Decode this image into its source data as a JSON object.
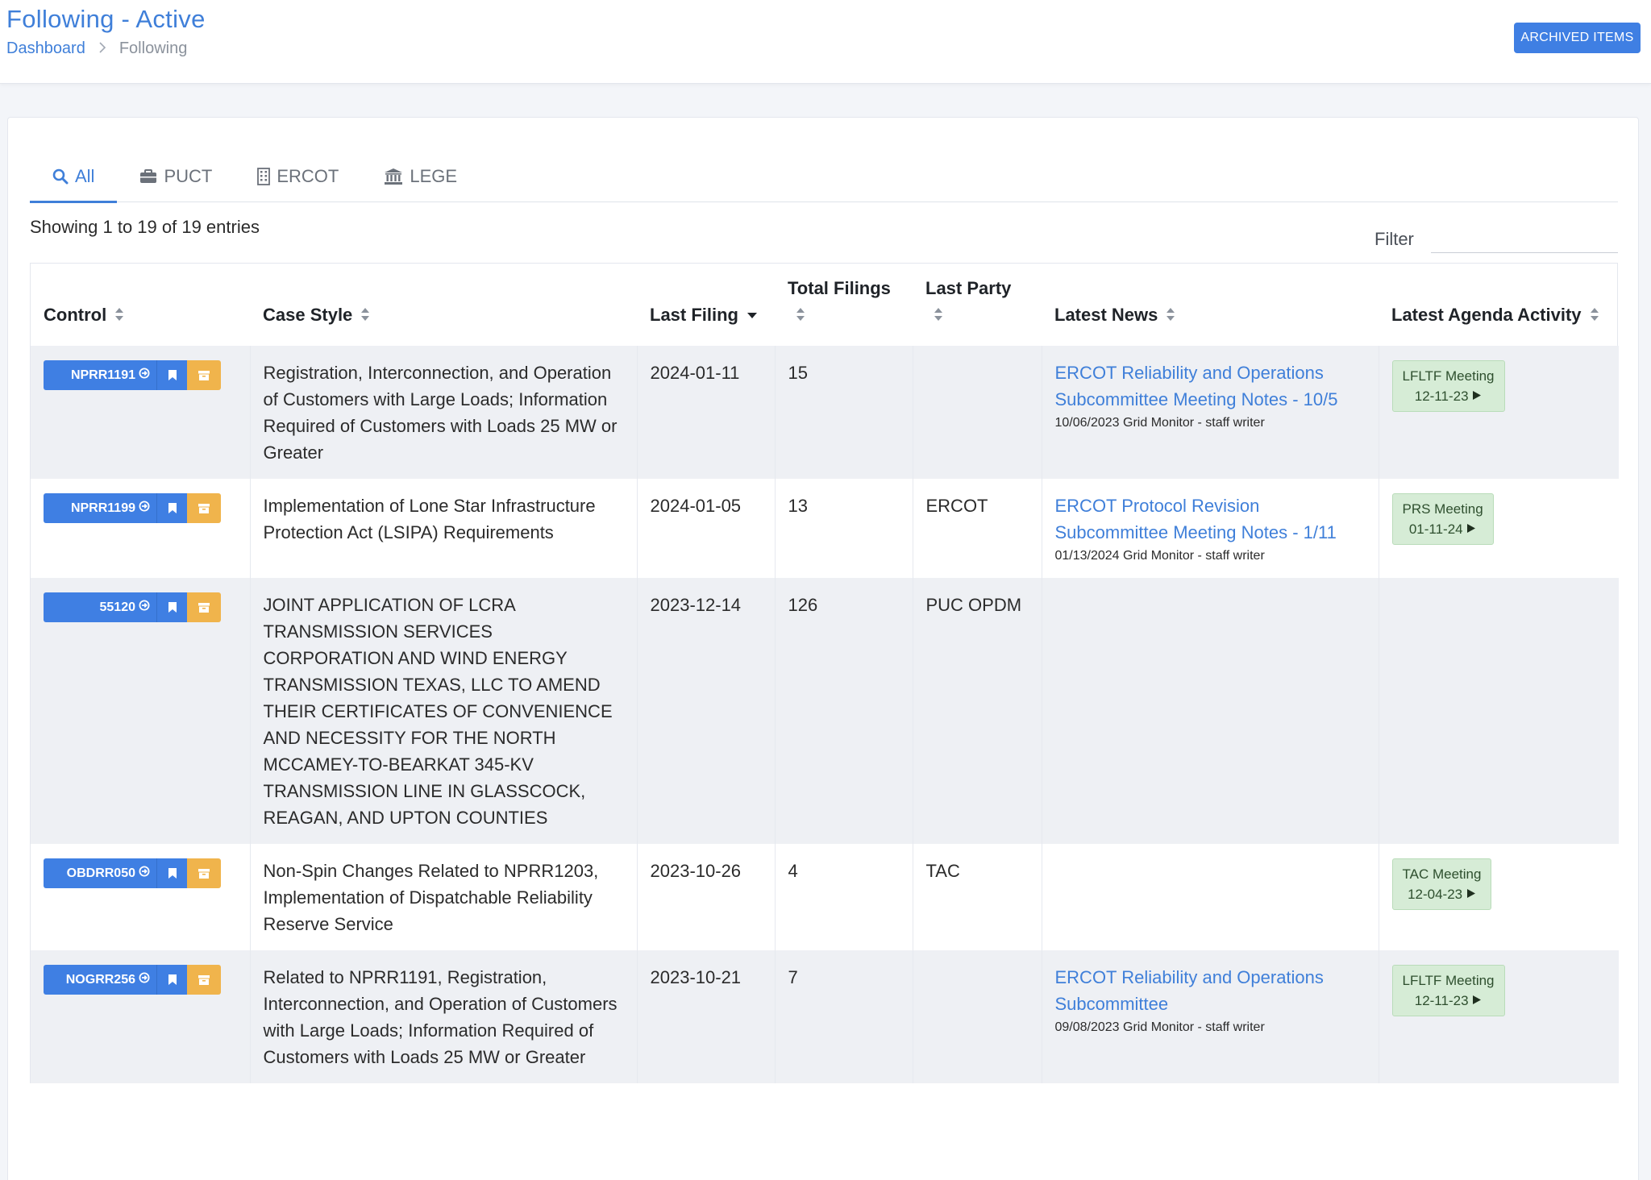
{
  "header": {
    "title": "Following - Active",
    "breadcrumb": {
      "home": "Dashboard",
      "separator": ">",
      "current": "Following"
    },
    "archived_label": "ARCHIVED ITEMS"
  },
  "tabs": [
    {
      "label": "All",
      "icon": "search-icon",
      "active": true
    },
    {
      "label": "PUCT",
      "icon": "briefcase-icon",
      "active": false
    },
    {
      "label": "ERCOT",
      "icon": "building-icon",
      "active": false
    },
    {
      "label": "LEGE",
      "icon": "bank-icon",
      "active": false
    }
  ],
  "table_info": {
    "showing": "Showing 1 to 19 of 19 entries",
    "filter_label": "Filter",
    "filter_value": ""
  },
  "columns": {
    "control": "Control",
    "case_style": "Case Style",
    "last_filing": "Last Filing",
    "total_filings": "Total Filings",
    "last_party": "Last Party",
    "latest_news": "Latest News",
    "latest_agenda": "Latest Agenda Activity"
  },
  "rows": [
    {
      "control": "NPRR1191",
      "case_style": "Registration, Interconnection, and Operation of Customers with Large Loads; Information Required of Customers with Loads 25 MW or Greater",
      "last_filing": "2024-01-11",
      "total_filings": "15",
      "last_party": "",
      "news_title": "ERCOT Reliability and Operations Subcommittee Meeting Notes - 10/5",
      "news_meta": "10/06/2023 Grid Monitor - staff writer",
      "agenda_name": "LFLTF Meeting",
      "agenda_date": "12-11-23"
    },
    {
      "control": "NPRR1199",
      "case_style": "Implementation of Lone Star Infrastructure Protection Act (LSIPA) Requirements",
      "last_filing": "2024-01-05",
      "total_filings": "13",
      "last_party": "ERCOT",
      "news_title": "ERCOT Protocol Revision Subcommittee Meeting Notes - 1/11",
      "news_meta": "01/13/2024 Grid Monitor - staff writer",
      "agenda_name": "PRS Meeting",
      "agenda_date": "01-11-24"
    },
    {
      "control": "55120",
      "case_style": "JOINT APPLICATION OF LCRA TRANSMISSION SERVICES CORPORATION AND WIND ENERGY TRANSMISSION TEXAS, LLC TO AMEND THEIR CERTIFICATES OF CONVENIENCE AND NECESSITY FOR THE NORTH MCCAMEY-TO-BEARKAT 345-KV TRANSMISSION LINE IN GLASSCOCK, REAGAN, AND UPTON COUNTIES",
      "last_filing": "2023-12-14",
      "total_filings": "126",
      "last_party": "PUC OPDM",
      "news_title": "",
      "news_meta": "",
      "agenda_name": "",
      "agenda_date": ""
    },
    {
      "control": "OBDRR050",
      "case_style": "Non-Spin Changes Related to NPRR1203, Implementation of Dispatchable Reliability Reserve Service",
      "last_filing": "2023-10-26",
      "total_filings": "4",
      "last_party": "TAC",
      "news_title": "",
      "news_meta": "",
      "agenda_name": "TAC Meeting",
      "agenda_date": "12-04-23"
    },
    {
      "control": "NOGRR256",
      "case_style": "Related to NPRR1191, Registration, Interconnection, and Operation of Customers with Large Loads; Information Required of Customers with Loads 25 MW or Greater",
      "last_filing": "2023-10-21",
      "total_filings": "7",
      "last_party": "",
      "news_title": "ERCOT Reliability and Operations Subcommittee",
      "news_meta": "09/08/2023 Grid Monitor - staff writer",
      "agenda_name": "LFLTF Meeting",
      "agenda_date": "12-11-23"
    }
  ],
  "colors": {
    "primary": "#3f7fe3",
    "archive": "#f0b44c",
    "agenda_bg": "#d6ecd6",
    "link": "#3f7fd9"
  }
}
